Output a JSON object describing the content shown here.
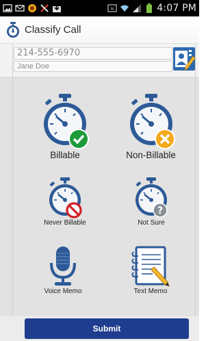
{
  "status_bar": {
    "time": "4:07 PM",
    "left_icons": [
      "gallery-icon",
      "mail-icon",
      "app-icon",
      "tools-icon",
      "download-icon"
    ],
    "right_icons": [
      "nfc-icon",
      "wifi-icon",
      "signal-icon",
      "battery-icon"
    ]
  },
  "app": {
    "title": "Classify Call",
    "icon": "stopwatch-icon"
  },
  "contact": {
    "phone": "214-555-6970",
    "name": "Jane Doe",
    "edit_icon": "contact-edit-icon"
  },
  "tiles": [
    {
      "label": "Billable",
      "icon": "stopwatch-check-icon"
    },
    {
      "label": "Non-Billable",
      "icon": "stopwatch-x-icon"
    },
    {
      "label": "Never Billable",
      "icon": "stopwatch-no-icon"
    },
    {
      "label": "Not Sure",
      "icon": "stopwatch-question-icon"
    },
    {
      "label": "Voice Memo",
      "icon": "microphone-icon"
    },
    {
      "label": "Text Memo",
      "icon": "notepad-icon"
    }
  ],
  "submit": {
    "label": "Submit"
  },
  "colors": {
    "accent": "#1f3d8e",
    "watch_blue": "#2d5a97",
    "check_green": "#1e9b3a",
    "x_orange": "#f3a81c",
    "no_red": "#d31f26",
    "question_gray": "#8a9097"
  }
}
